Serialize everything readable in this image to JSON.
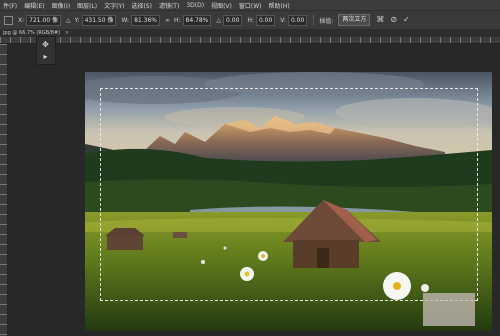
{
  "menubar": {
    "items": [
      "件(F)",
      "编辑(E)",
      "图像(I)",
      "图层(L)",
      "文字(Y)",
      "选择(S)",
      "滤镜(T)",
      "3D(D)",
      "视图(V)",
      "窗口(W)",
      "帮助(H)"
    ]
  },
  "options": {
    "x_label": "X:",
    "x_value": "721.00 像",
    "y_label": "Y:",
    "y_value": "431.50 像",
    "w_label": "W:",
    "w_value": "81.36%",
    "h_label": "H:",
    "h_value": "84.78%",
    "angle_label": "△",
    "angle_value": "0.00",
    "hskew_label": "H:",
    "hskew_value": "0.00",
    "vskew_label": "V:",
    "vskew_value": "0.00",
    "interp_label": "插值:",
    "interp_value": "两次立方",
    "warp_glyph": "⌘",
    "cancel_glyph": "⊘",
    "commit_glyph": "✓"
  },
  "document_tab": {
    "title": "jpg @ 66.7% (RGB/8#)",
    "close": "×",
    "extra": "RGB/8#)"
  },
  "tools": {
    "move_glyph": "✥",
    "arrow_glyph": "▸"
  }
}
